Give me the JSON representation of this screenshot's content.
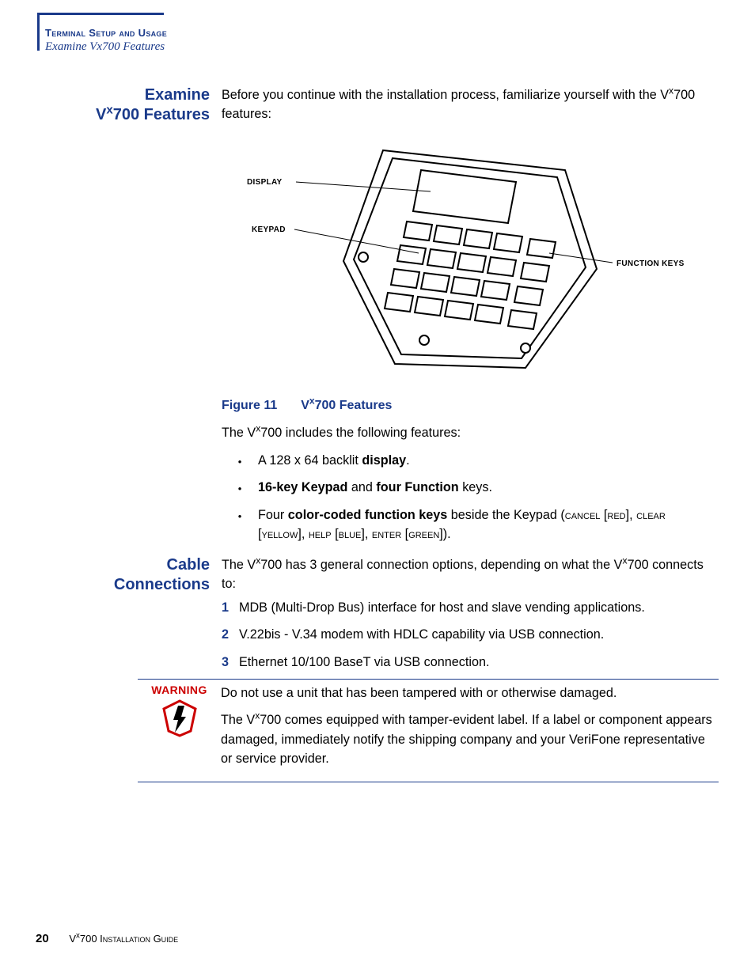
{
  "runningHead": {
    "line1": "Terminal Setup and Usage",
    "line2_prefix": "Examine V",
    "line2_sup": "x",
    "line2_suffix": "700 Features"
  },
  "sectionExamine": {
    "head_l1": "Examine",
    "head_l2_prefix": "V",
    "head_l2_sup": "x",
    "head_l2_suffix": "700 Features",
    "intro_prefix": "Before you continue with the installation process, familiarize yourself with the V",
    "intro_sup": "x",
    "intro_suffix": "700 features:"
  },
  "diagramLabels": {
    "display": "DISPLAY",
    "keypad": "KEYPAD",
    "functionKeys": "FUNCTION KEYS"
  },
  "figCaption": {
    "num": "Figure 11",
    "title_prefix": "V",
    "title_sup": "x",
    "title_suffix": "700 Features"
  },
  "featuresIntro_prefix": "The V",
  "featuresIntro_sup": "x",
  "featuresIntro_suffix": "700 includes the following features:",
  "bullets": {
    "b1_pre": "A 128 x 64 backlit ",
    "b1_bold": "display",
    "b1_post": ".",
    "b2_bold1": "16-key Keypad",
    "b2_mid": " and ",
    "b2_bold2": "four Function",
    "b2_post": " keys.",
    "b3_pre": "Four ",
    "b3_bold": "color-coded function keys",
    "b3_mid": " beside the Keypad (",
    "b3_sc1": "cancel",
    "b3_br1": " [",
    "b3_sc2": "red",
    "b3_br2": "], ",
    "b3_sc3": "clear",
    "b3_br3": " [",
    "b3_sc4": "yellow",
    "b3_br4": "], ",
    "b3_sc5": "help",
    "b3_br5": " [",
    "b3_sc6": "blue",
    "b3_br6": "], ",
    "b3_sc7": "enter",
    "b3_br7": " [",
    "b3_sc8": "green",
    "b3_br8": "])."
  },
  "sectionCable": {
    "head_l1": "Cable",
    "head_l2": "Connections",
    "intro_prefix": "The V",
    "intro_sup": "x",
    "intro_mid": "700 has 3 general connection options, depending on what the V",
    "intro_sup2": "x",
    "intro_suffix": "700 connects to:"
  },
  "numlist": {
    "n1": "1",
    "t1": "MDB (Multi-Drop Bus) interface for host and slave vending applications.",
    "n2": "2",
    "t2": "V.22bis - V.34 modem with HDLC capability via USB connection.",
    "n3": "3",
    "t3": "Ethernet 10/100 BaseT via USB connection."
  },
  "warning": {
    "label": "WARNING",
    "p1": "Do not use a unit that has been tampered with or otherwise damaged.",
    "p2_prefix": "The V",
    "p2_sup": "x",
    "p2_suffix": "700 comes equipped with tamper-evident label. If a label or component appears damaged, immediately notify the shipping company and your VeriFone representative or service provider."
  },
  "footer": {
    "page": "20",
    "title_prefix": "V",
    "title_sup": "x",
    "title_suffix": "700 Installation Guide"
  }
}
